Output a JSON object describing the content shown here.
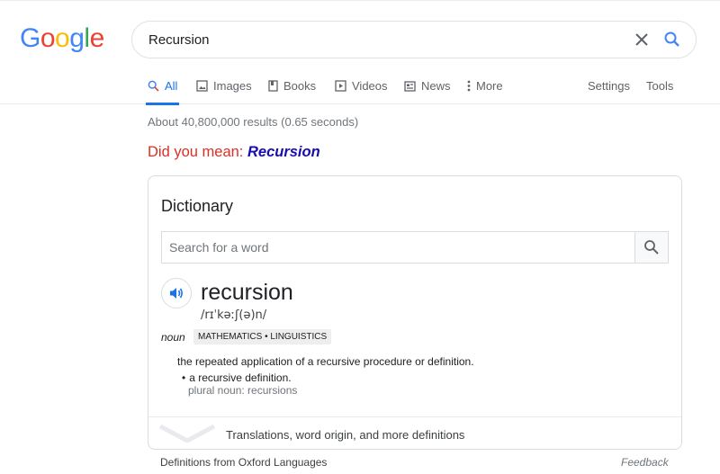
{
  "logo": {
    "letters": [
      "G",
      "o",
      "o",
      "g",
      "l",
      "e"
    ],
    "colors": [
      "#4285F4",
      "#EA4335",
      "#FBBC05",
      "#4285F4",
      "#34A853",
      "#EA4335"
    ]
  },
  "search": {
    "query": "Recursion"
  },
  "tabs": {
    "all": "All",
    "images": "Images",
    "books": "Books",
    "videos": "Videos",
    "news": "News",
    "more": "More",
    "settings": "Settings",
    "tools": "Tools"
  },
  "results": {
    "stats": "About 40,800,000 results (0.65 seconds)",
    "did_you_mean_prefix": "Did you mean:",
    "did_you_mean_term": "Recursion"
  },
  "dictionary": {
    "title": "Dictionary",
    "search_placeholder": "Search for a word",
    "word": "recursion",
    "pronunciation": "/rɪˈkəːʃ(ə)n/",
    "part_of_speech": "noun",
    "domain_badge": "MATHEMATICS • LINGUISTICS",
    "definition": "the repeated application of a recursive procedure or definition.",
    "sub_definition": "a recursive definition.",
    "plural": "plural noun: recursions",
    "more_link": "Translations, word origin, and more definitions"
  },
  "footer": {
    "source": "Definitions from Oxford Languages",
    "feedback": "Feedback"
  },
  "colors": {
    "accent_blue": "#1a73e8",
    "did_you_mean_red": "#d93025",
    "link_blue": "#1a0dab"
  }
}
